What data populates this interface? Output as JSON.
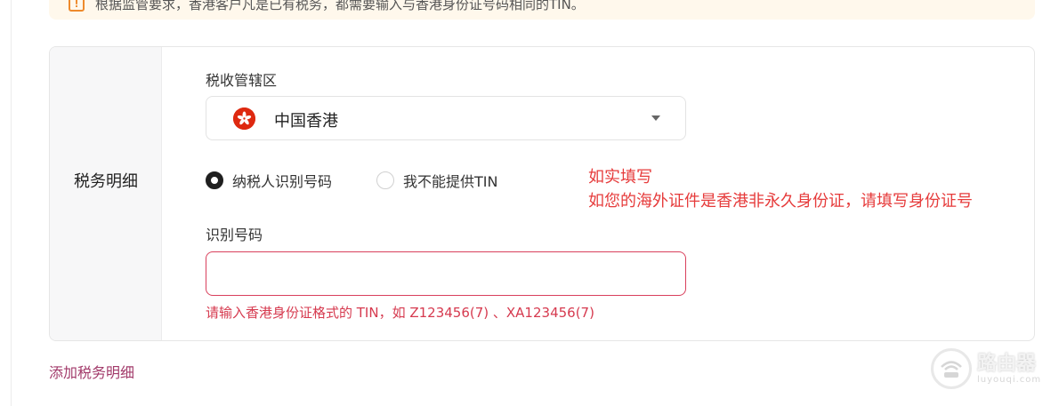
{
  "notice": {
    "text": "根据监管要求，香港客户凡是已有税务，都需要输入与香港身份证号码相同的TIN。",
    "icon": "warning-icon",
    "icon_color": "#ee8a2c"
  },
  "tax_section": {
    "side_label": "税务明细",
    "jurisdiction": {
      "label": "税收管辖区",
      "value": "中国香港",
      "flag_icon": "hong-kong-flag-icon"
    },
    "tin_options": [
      {
        "label": "纳税人识别号码",
        "checked": true
      },
      {
        "label": "我不能提供TIN",
        "checked": false
      }
    ],
    "id_number": {
      "label": "识别号码",
      "value": "",
      "placeholder": "",
      "error": "请输入香港身份证格式的 TIN，如 Z123456(7) 、XA123456(7)"
    }
  },
  "annotation": {
    "line1": "如实填写",
    "line2": "如您的海外证件是香港非永久身份证，请填写身份证号",
    "color": "#e63b3b"
  },
  "add_link": "添加税务明细",
  "watermark": {
    "brand": "路由器",
    "url": "luyouqi.com"
  },
  "colors": {
    "accent": "#a23a6a",
    "error": "#d63a4f",
    "notice_bg": "#fff8ec"
  }
}
